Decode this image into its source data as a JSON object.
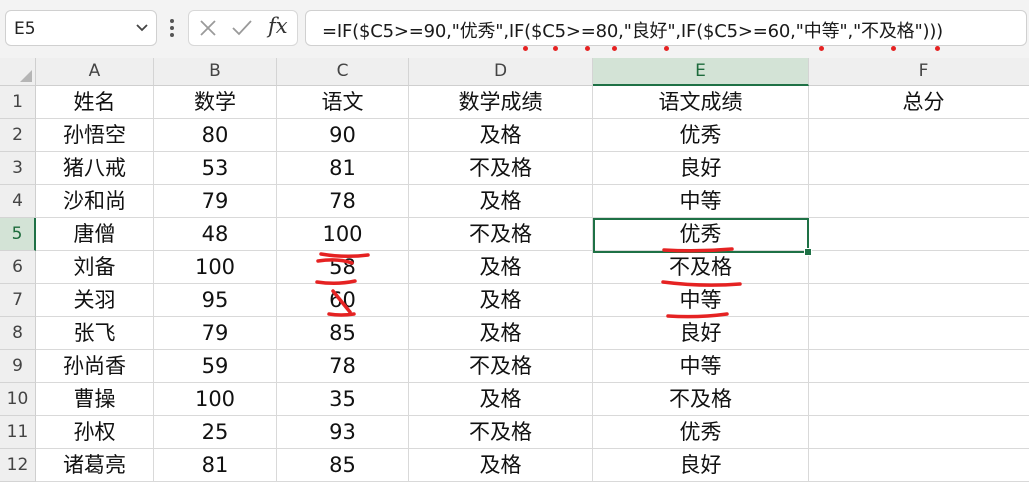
{
  "name_box": {
    "value": "E5"
  },
  "formula_bar": {
    "fx_label": "fx",
    "formula": "=IF($C5>=90,\"优秀\",IF($C5>=80,\"良好\",IF($C5>=60,\"中等\",\"不及格\")))"
  },
  "columns": [
    "A",
    "B",
    "C",
    "D",
    "E",
    "F"
  ],
  "rows": [
    {
      "num": "1",
      "cells": [
        "姓名",
        "数学",
        "语文",
        "数学成绩",
        "语文成绩",
        "总分"
      ]
    },
    {
      "num": "2",
      "cells": [
        "孙悟空",
        "80",
        "90",
        "及格",
        "优秀",
        ""
      ]
    },
    {
      "num": "3",
      "cells": [
        "猪八戒",
        "53",
        "81",
        "不及格",
        "良好",
        ""
      ]
    },
    {
      "num": "4",
      "cells": [
        "沙和尚",
        "79",
        "78",
        "及格",
        "中等",
        ""
      ]
    },
    {
      "num": "5",
      "cells": [
        "唐僧",
        "48",
        "100",
        "不及格",
        "优秀",
        ""
      ]
    },
    {
      "num": "6",
      "cells": [
        "刘备",
        "100",
        "58",
        "及格",
        "不及格",
        ""
      ]
    },
    {
      "num": "7",
      "cells": [
        "关羽",
        "95",
        "60",
        "及格",
        "中等",
        ""
      ]
    },
    {
      "num": "8",
      "cells": [
        "张飞",
        "79",
        "85",
        "及格",
        "良好",
        ""
      ]
    },
    {
      "num": "9",
      "cells": [
        "孙尚香",
        "59",
        "78",
        "不及格",
        "中等",
        ""
      ]
    },
    {
      "num": "10",
      "cells": [
        "曹操",
        "100",
        "35",
        "及格",
        "不及格",
        ""
      ]
    },
    {
      "num": "11",
      "cells": [
        "孙权",
        "25",
        "93",
        "不及格",
        "优秀",
        ""
      ]
    },
    {
      "num": "12",
      "cells": [
        "诸葛亮",
        "81",
        "85",
        "及格",
        "良好",
        ""
      ]
    }
  ],
  "selection": {
    "column": "E",
    "row": "5"
  },
  "colors": {
    "accent": "#1e7145",
    "annotation": "#e52222"
  }
}
